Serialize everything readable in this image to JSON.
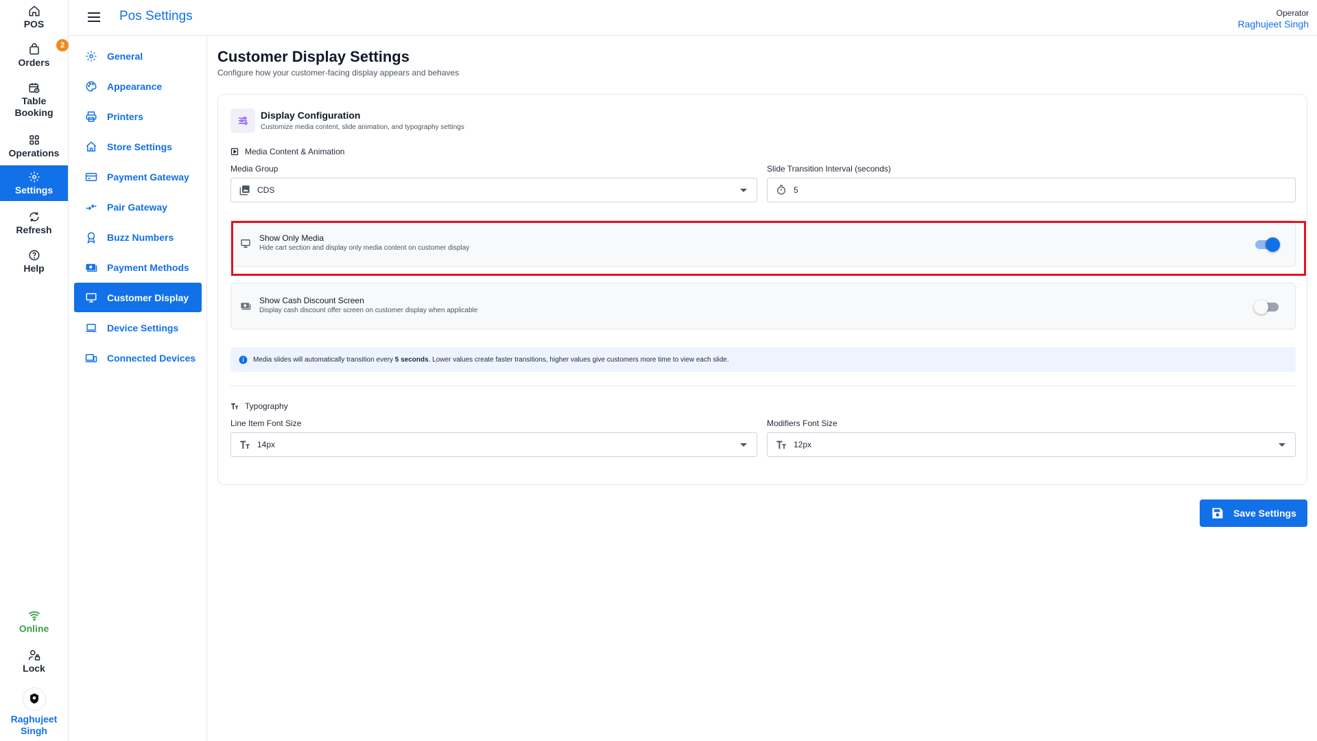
{
  "rail": {
    "pos": "POS",
    "orders": "Orders",
    "orders_badge": "2",
    "table_booking_1": "Table",
    "table_booking_2": "Booking",
    "operations": "Operations",
    "settings": "Settings",
    "refresh": "Refresh",
    "help": "Help",
    "online": "Online",
    "lock": "Lock",
    "user_1": "Raghujeet",
    "user_2": "Singh"
  },
  "topbar": {
    "title": "Pos Settings",
    "operator_label": "Operator",
    "operator_name": "Raghujeet Singh"
  },
  "subnav": {
    "items": [
      {
        "label": "General",
        "icon": "gear-icon"
      },
      {
        "label": "Appearance",
        "icon": "palette-icon"
      },
      {
        "label": "Printers",
        "icon": "printer-icon"
      },
      {
        "label": "Store Settings",
        "icon": "store-icon"
      },
      {
        "label": "Payment Gateway",
        "icon": "card-icon"
      },
      {
        "label": "Pair Gateway",
        "icon": "pair-icon"
      },
      {
        "label": "Buzz Numbers",
        "icon": "badge-icon"
      },
      {
        "label": "Payment Methods",
        "icon": "cash-icon"
      },
      {
        "label": "Customer Display",
        "icon": "monitor-icon"
      },
      {
        "label": "Device Settings",
        "icon": "laptop-icon"
      },
      {
        "label": "Connected Devices",
        "icon": "devices-icon"
      }
    ],
    "active_index": 8
  },
  "page": {
    "title": "Customer Display Settings",
    "subtitle": "Configure how your customer-facing display appears and behaves"
  },
  "card": {
    "title": "Display Configuration",
    "subtitle": "Customize media content, slide animation, and typography settings",
    "media_section": "Media Content & Animation",
    "media_group_label": "Media Group",
    "media_group_value": "CDS",
    "interval_label": "Slide Transition Interval (seconds)",
    "interval_value": "5",
    "show_only_media": {
      "title": "Show Only Media",
      "subtitle": "Hide cart section and display only media content on customer display",
      "enabled": true
    },
    "show_cash_discount": {
      "title": "Show Cash Discount Screen",
      "subtitle": "Display cash discount offer screen on customer display when applicable",
      "enabled": false
    },
    "info": {
      "prefix": "Media slides will automatically transition every ",
      "bold": "5 seconds",
      "suffix": ". Lower values create faster transitions, higher values give customers more time to view each slide."
    },
    "typography_section": "Typography",
    "line_item_label": "Line Item Font Size",
    "line_item_value": "14px",
    "modifiers_label": "Modifiers Font Size",
    "modifiers_value": "12px"
  },
  "save_button": "Save Settings",
  "colors": {
    "primary": "#1270e8",
    "badge": "#f08a1c",
    "online": "#3aa04a",
    "highlight": "#e3131f"
  }
}
